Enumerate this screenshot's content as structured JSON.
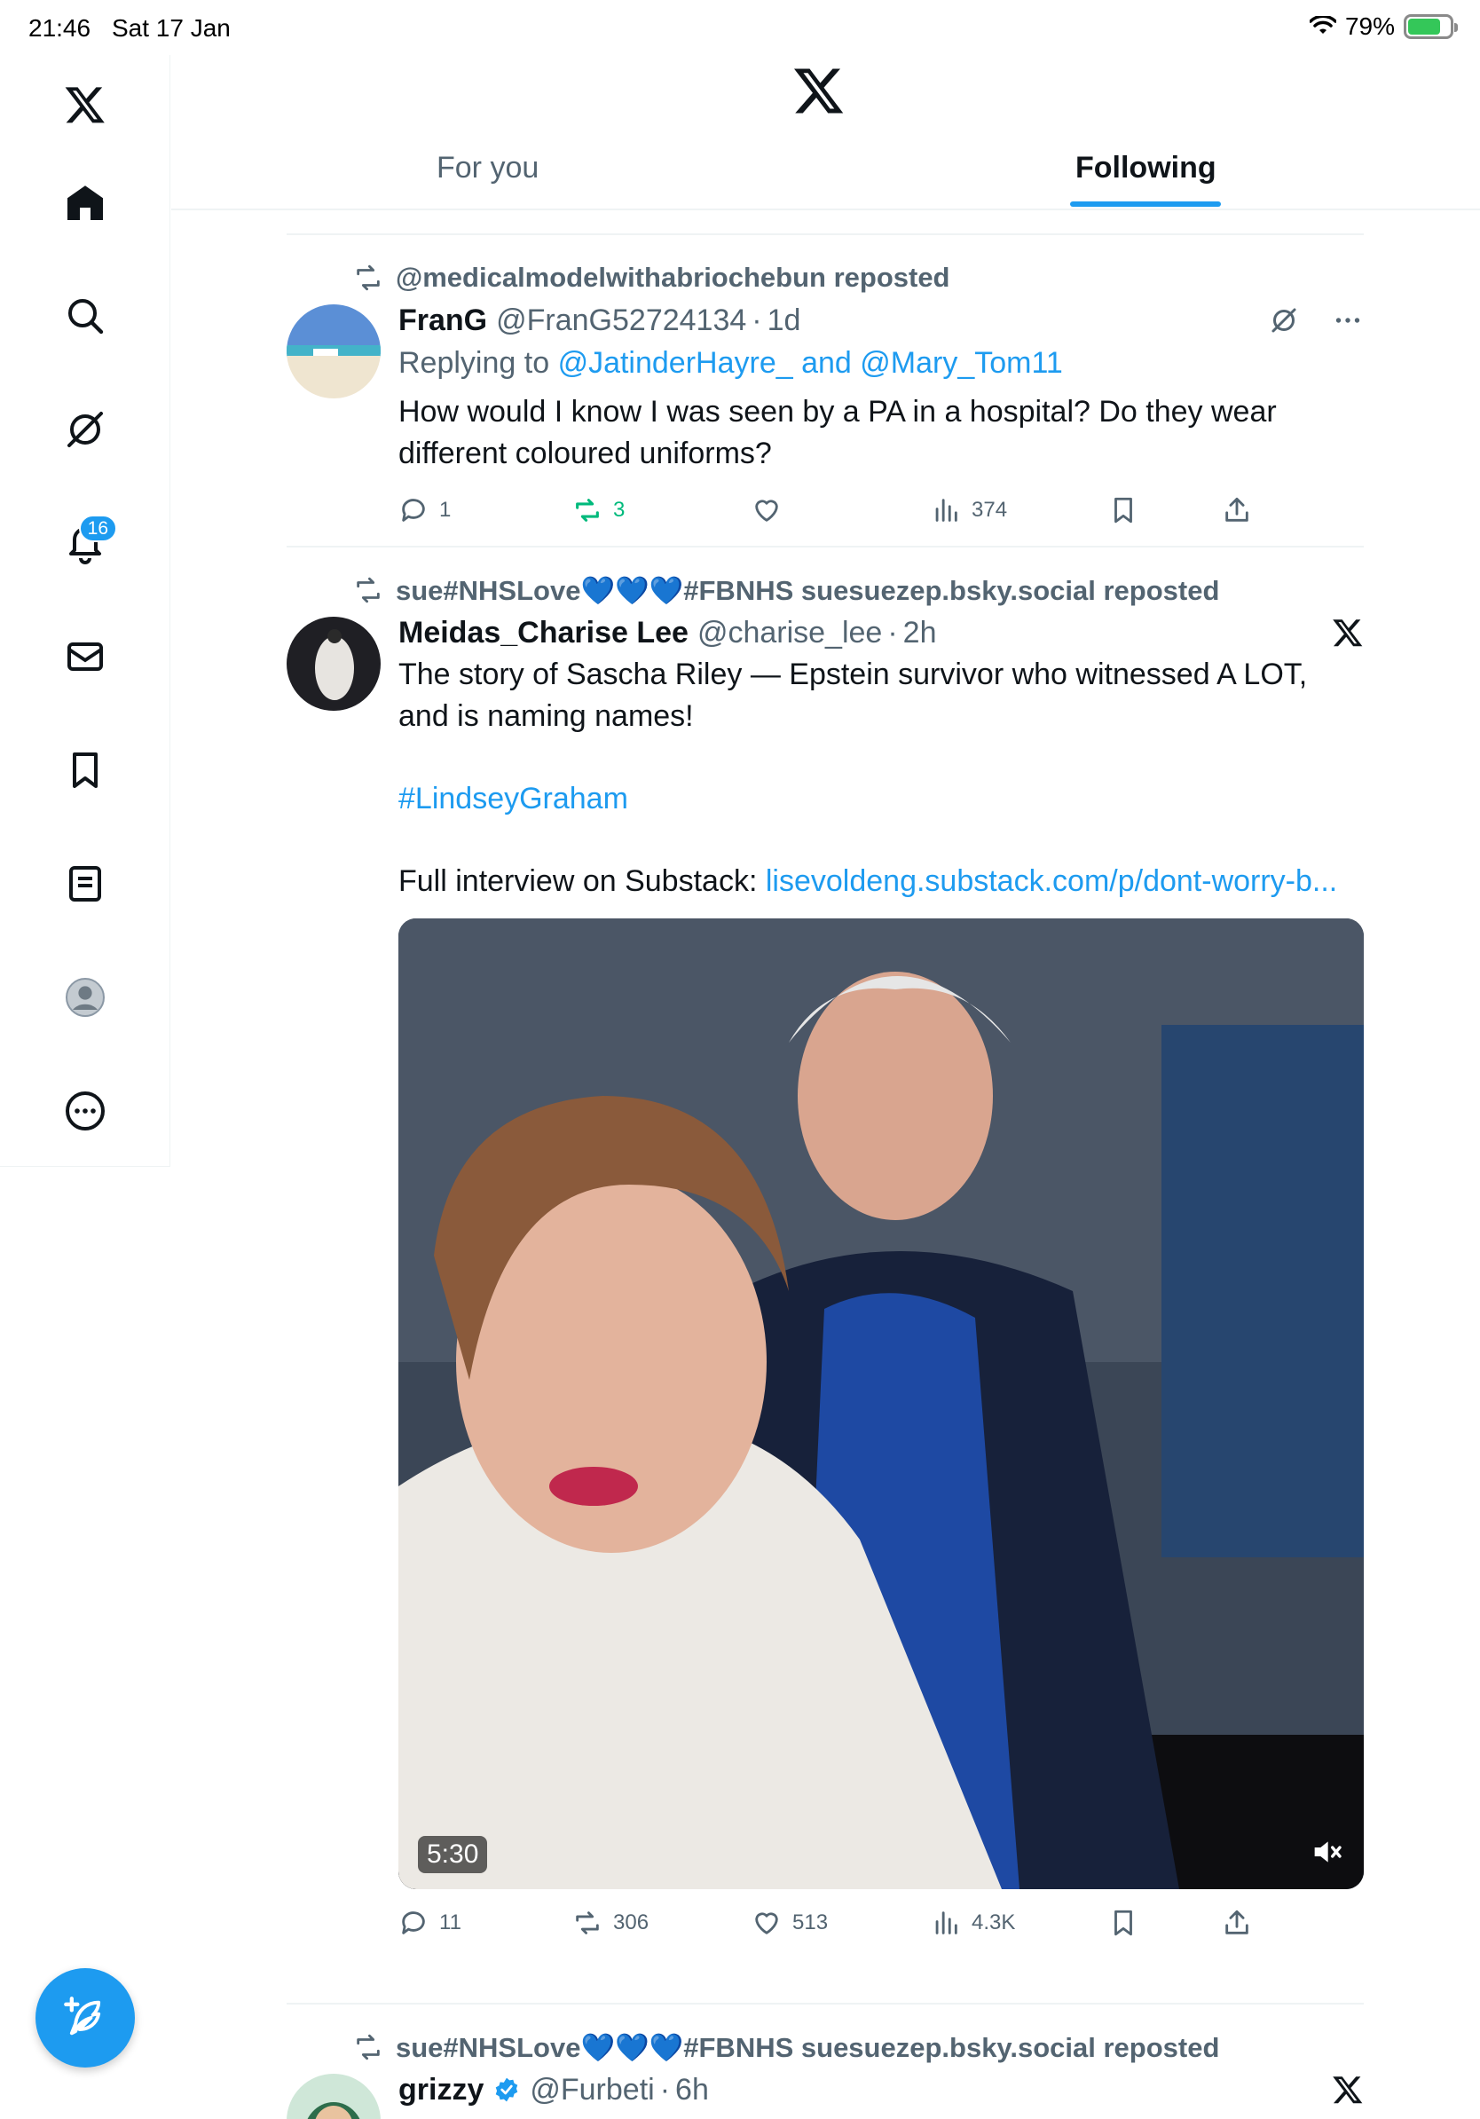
{
  "status_bar": {
    "time": "21:46",
    "date": "Sat 17 Jan",
    "battery": "79%"
  },
  "sidebar": {
    "notifications_badge": "16"
  },
  "header": {
    "tabs": [
      {
        "label": "For you"
      },
      {
        "label": "Following"
      }
    ]
  },
  "posts": [
    {
      "reposted_by": "@medicalmodelwithabriochebun reposted",
      "name": "FranG",
      "handle": "@FranG52724134",
      "time": "1d",
      "replying_prefix": "Replying to",
      "replying_users": "@JatinderHayre_ and @Mary_Tom11",
      "text": "How would I know I was seen by a PA in a hospital? Do they wear different coloured uniforms?",
      "replies": "1",
      "reposts": "3",
      "likes": "",
      "views": "374"
    },
    {
      "reposted_by": "sue#NHSLove💙💙💙#FBNHS suesuezep.bsky.social reposted",
      "name": "Meidas_Charise Lee",
      "handle": "@charise_lee",
      "time": "2h",
      "text": "The story of Sascha Riley — Epstein survivor who witnessed A LOT, and is naming names!",
      "hashtag": "#LindseyGraham",
      "substack_prefix": "Full interview on Substack:",
      "substack_link": "lisevoldeng.substack.com/p/dont-worry-b...",
      "video_duration": "5:30",
      "replies": "11",
      "reposts": "306",
      "likes": "513",
      "views": "4.3K"
    },
    {
      "reposted_by": "sue#NHSLove💙💙💙#FBNHS suesuezep.bsky.social reposted",
      "name": "grizzy",
      "handle": "@Furbeti",
      "time": "6h"
    }
  ],
  "colors": {
    "accent": "#1d9bf0",
    "repost_green": "#00ba7c",
    "muted": "#536471"
  }
}
